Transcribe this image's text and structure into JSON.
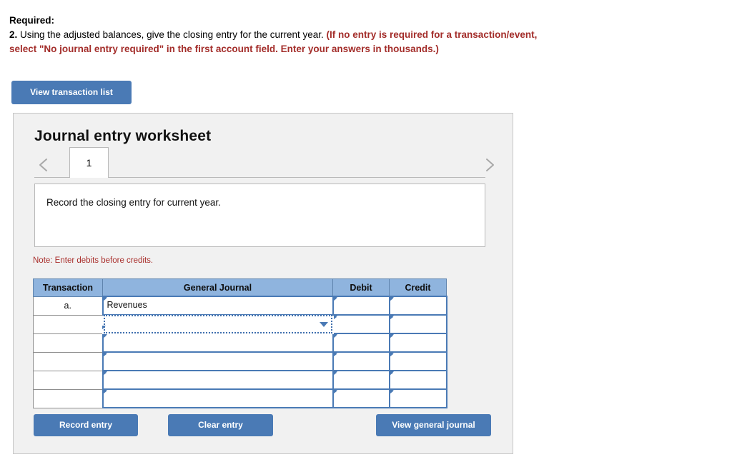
{
  "instructions": {
    "required_label": "Required:",
    "question_number": "2.",
    "question_text": " Using the adjusted balances, give the closing entry for the current year. ",
    "hint_line1": "(If no entry is required for a transaction/event,",
    "hint_line2": "select \"No journal entry required\" in the first account field. Enter your answers in thousands.)",
    "hint_color": "#a32d2a"
  },
  "toolbar": {
    "view_transaction_list_label": "View transaction list"
  },
  "worksheet": {
    "title": "Journal entry worksheet",
    "prev_icon": "chevron-left-icon",
    "next_icon": "chevron-right-icon",
    "tabs": [
      {
        "label": "1",
        "active": true
      }
    ],
    "description": "Record the closing entry for current year.",
    "note": "Note: Enter debits before credits.",
    "note_color": "#a92f2c"
  },
  "table": {
    "headers": [
      "Transaction",
      "General Journal",
      "Debit",
      "Credit"
    ],
    "header_bg": "#8fb4de",
    "rows": [
      {
        "transaction": "a.",
        "general_journal": "Revenues",
        "debit": "",
        "credit": "",
        "selected": false
      },
      {
        "transaction": "",
        "general_journal": "",
        "debit": "",
        "credit": "",
        "selected": true
      },
      {
        "transaction": "",
        "general_journal": "",
        "debit": "",
        "credit": "",
        "selected": false
      },
      {
        "transaction": "",
        "general_journal": "",
        "debit": "",
        "credit": "",
        "selected": false
      },
      {
        "transaction": "",
        "general_journal": "",
        "debit": "",
        "credit": "",
        "selected": false
      },
      {
        "transaction": "",
        "general_journal": "",
        "debit": "",
        "credit": "",
        "selected": false
      }
    ]
  },
  "footer": {
    "record_entry_label": "Record entry",
    "clear_entry_label": "Clear entry",
    "view_general_journal_label": "View general journal",
    "button_color": "#4a7ab5"
  }
}
